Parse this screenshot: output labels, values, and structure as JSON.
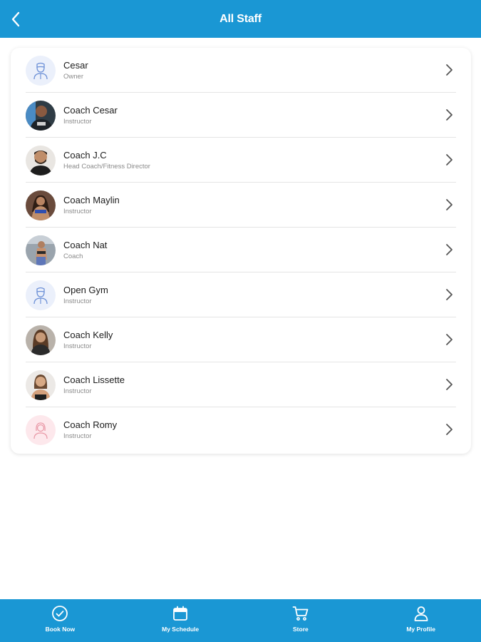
{
  "header": {
    "title": "All Staff",
    "back_icon": "chevron-left-icon"
  },
  "staff": [
    {
      "name": "Cesar",
      "role": "Owner",
      "avatar": "placeholder-male"
    },
    {
      "name": "Coach Cesar",
      "role": "Instructor",
      "avatar": "photo"
    },
    {
      "name": "Coach J.C",
      "role": "Head Coach/Fitness Director",
      "avatar": "photo"
    },
    {
      "name": "Coach Maylin",
      "role": "Instructor",
      "avatar": "photo"
    },
    {
      "name": "Coach Nat",
      "role": "Coach",
      "avatar": "photo"
    },
    {
      "name": "Open Gym",
      "role": "Instructor",
      "avatar": "placeholder-male"
    },
    {
      "name": "Coach Kelly",
      "role": "Instructor",
      "avatar": "photo"
    },
    {
      "name": "Coach Lissette",
      "role": "Instructor",
      "avatar": "photo"
    },
    {
      "name": "Coach Romy",
      "role": "Instructor",
      "avatar": "placeholder-female"
    }
  ],
  "tabbar": [
    {
      "label": "Book Now",
      "icon": "check-circle-icon"
    },
    {
      "label": "My Schedule",
      "icon": "calendar-icon"
    },
    {
      "label": "Store",
      "icon": "cart-icon"
    },
    {
      "label": "My Profile",
      "icon": "user-icon"
    }
  ],
  "colors": {
    "primary": "#1a97d4",
    "background": "#ffffff",
    "divider": "#e4e4e4",
    "placeholder_bg": "#ebf0fb",
    "placeholder_pink_bg": "#fde8ec"
  }
}
